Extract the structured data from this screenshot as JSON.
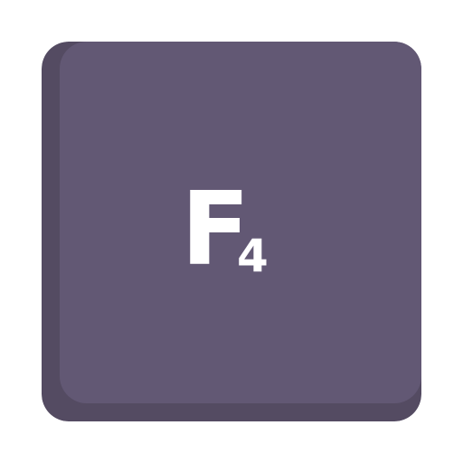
{
  "key": {
    "main_label": "F",
    "sub_label": "4",
    "colors": {
      "face": "#625874",
      "shadow": "#544b62",
      "text": "#ffffff"
    }
  }
}
